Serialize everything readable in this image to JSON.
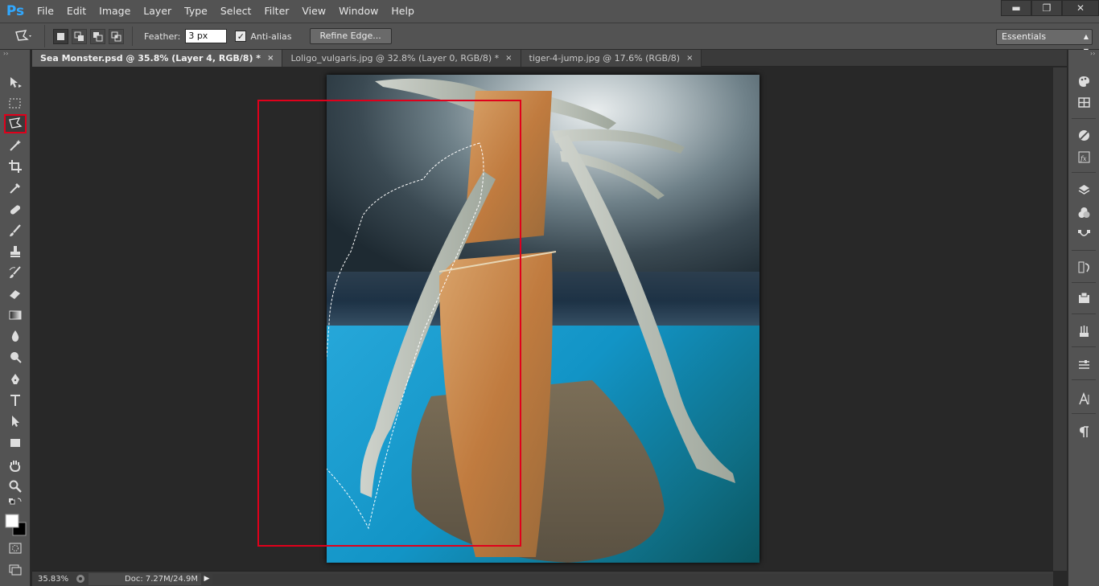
{
  "app": {
    "logo": "Ps"
  },
  "menu": [
    "File",
    "Edit",
    "Image",
    "Layer",
    "Type",
    "Select",
    "Filter",
    "View",
    "Window",
    "Help"
  ],
  "window_controls": {
    "minimize": "▬",
    "restore": "❐",
    "close": "✕"
  },
  "options": {
    "feather_label": "Feather:",
    "feather_value": "3 px",
    "antialias_label": "Anti-alias",
    "antialias_checked": "✓",
    "refine_label": "Refine Edge...",
    "workspace": "Essentials"
  },
  "tabs": [
    {
      "label": "Sea Monster.psd @ 35.8% (Layer 4, RGB/8) *",
      "active": true
    },
    {
      "label": "Loligo_vulgaris.jpg @ 32.8% (Layer 0, RGB/8) *",
      "active": false
    },
    {
      "label": "tiger-4-jump.jpg @ 17.6% (RGB/8)",
      "active": false
    }
  ],
  "tab_close": "×",
  "toolbar": {
    "collapse_glyph": "››",
    "selected_tool": "polygonal-lasso-icon"
  },
  "dock": {
    "collapse_glyph": "››"
  },
  "status": {
    "zoom": "35.83%",
    "doc_info": "Doc: 7.27M/24.9M",
    "arrow": "▶"
  },
  "colors": {
    "chrome": "#535353",
    "canvas_bg": "#282828",
    "highlight": "#e0001b",
    "ps_blue": "#31a8ff"
  }
}
